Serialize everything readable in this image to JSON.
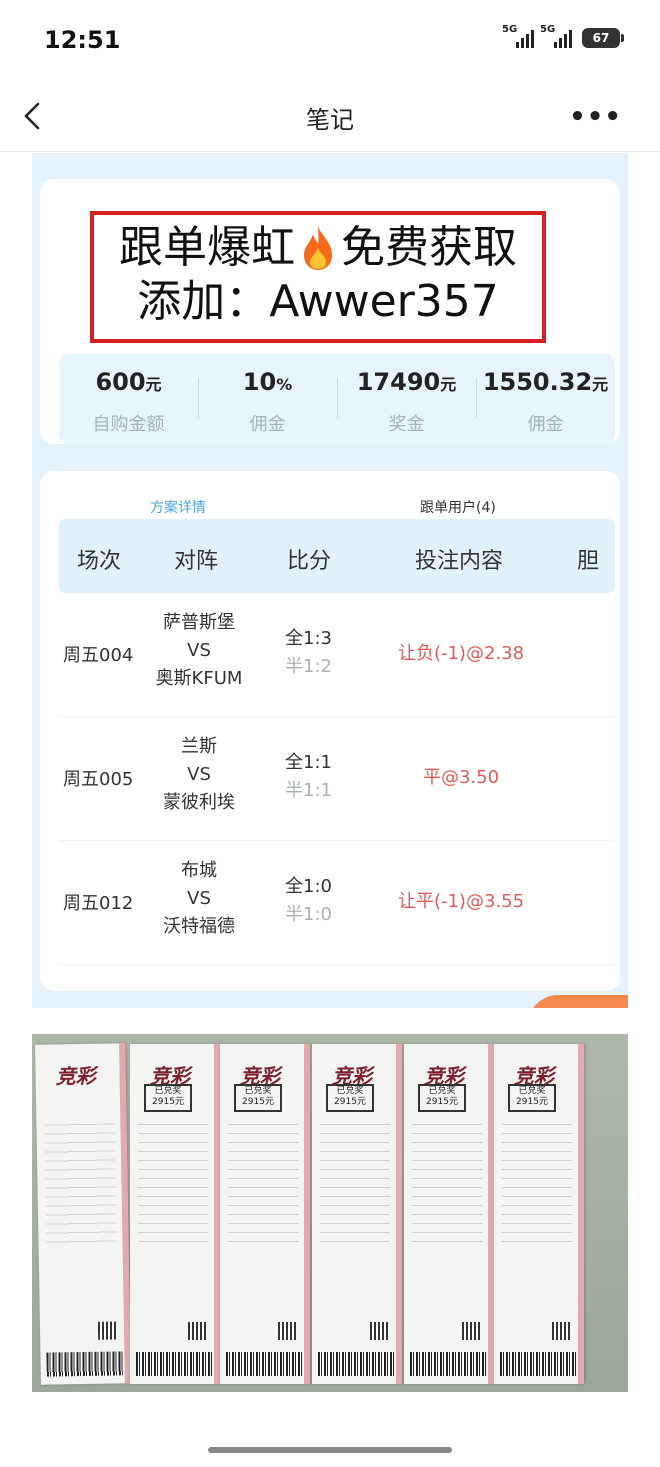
{
  "status_bar": {
    "time": "12:51",
    "signal1_label": "5G",
    "signal2_label": "5G",
    "battery": "67"
  },
  "nav": {
    "title": "笔记",
    "back_icon": "chevron-left-icon",
    "more_label": "•••"
  },
  "promo": {
    "line1_left": "跟单爆虹",
    "line1_right": "免费获取",
    "line2": "添加：Awwer357",
    "border_color": "#d42020"
  },
  "stats": [
    {
      "value": "600",
      "unit": "元",
      "label": "自购金额"
    },
    {
      "value": "10",
      "unit": "%",
      "label": "佣金"
    },
    {
      "value": "17490",
      "unit": "元",
      "label": "奖金"
    },
    {
      "value": "1550.32",
      "unit": "元",
      "label": "佣金"
    }
  ],
  "tabs": {
    "detail": "方案详情",
    "followers": "跟单用户(4)"
  },
  "table": {
    "headers": [
      "场次",
      "对阵",
      "比分",
      "投注内容",
      "胆"
    ],
    "rows": [
      {
        "no": "周五004",
        "home": "萨普斯堡",
        "vs": "VS",
        "away": "奥斯KFUM",
        "full": "全1:3",
        "half": "半1:2",
        "bet": "让负(-1)@2.38"
      },
      {
        "no": "周五005",
        "home": "兰斯",
        "vs": "VS",
        "away": "蒙彼利埃",
        "full": "全1:1",
        "half": "半1:1",
        "bet": "平@3.50"
      },
      {
        "no": "周五012",
        "home": "布城",
        "vs": "VS",
        "away": "沃特福德",
        "full": "全1:0",
        "half": "半1:0",
        "bet": "让平(-1)@3.55"
      }
    ]
  },
  "photo": {
    "ticket_logo": "竞彩",
    "ticket_stamp_line1": "已兑奖",
    "ticket_stamp_line2": "2915元"
  },
  "colors": {
    "accent_blue": "#4aa6dc",
    "bet_red": "#e05a5a",
    "panel_bg": "#e5f2fb"
  }
}
